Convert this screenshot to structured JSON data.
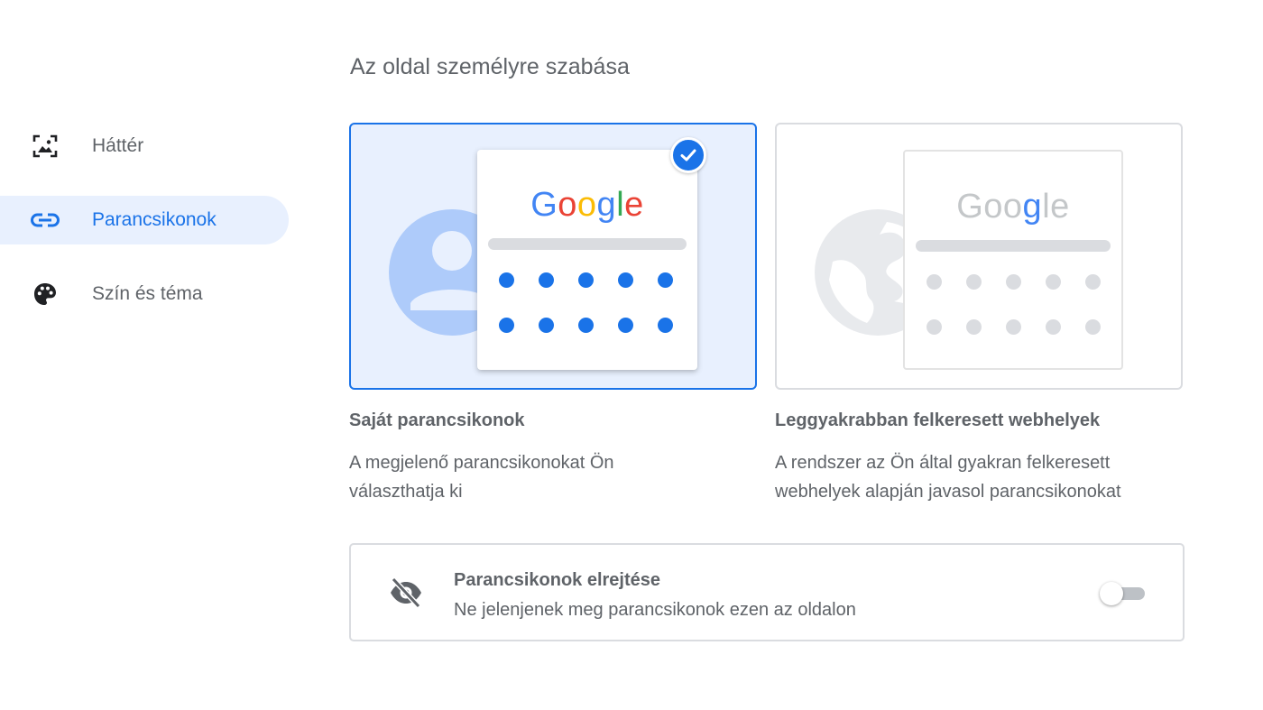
{
  "page": {
    "title": "Az oldal személyre szabása"
  },
  "sidebar": {
    "items": [
      {
        "label": "Háttér",
        "icon": "image-icon",
        "active": false
      },
      {
        "label": "Parancsikonok",
        "icon": "link-icon",
        "active": true
      },
      {
        "label": "Szín és téma",
        "icon": "palette-icon",
        "active": false
      }
    ]
  },
  "options": [
    {
      "title": "Saját parancsikonok",
      "description": "A megjelenő parancsikonokat Ön választhatja ki",
      "selected": true,
      "illustration_logo": "Google",
      "illustration_icon": "person-icon"
    },
    {
      "title": "Leggyakrabban felkeresett webhelyek",
      "description": "A rendszer az Ön által gyakran felkeresett webhelyek alapján javasol parancsikonokat",
      "selected": false,
      "illustration_logo": "Google",
      "illustration_icon": "globe-icon"
    }
  ],
  "hide_shortcuts": {
    "title": "Parancsikonok elrejtése",
    "subtitle": "Ne jelenjenek meg parancsikonok ezen az oldalon",
    "enabled": false,
    "icon": "eye-off-icon"
  },
  "colors": {
    "accent": "#1a73e8",
    "selected_bg": "#e8f0fe",
    "text": "#5f6368",
    "border": "#dadce0",
    "google_blue": "#4285f4",
    "google_red": "#ea4335",
    "google_yellow": "#fbbc05",
    "google_green": "#34a853"
  }
}
